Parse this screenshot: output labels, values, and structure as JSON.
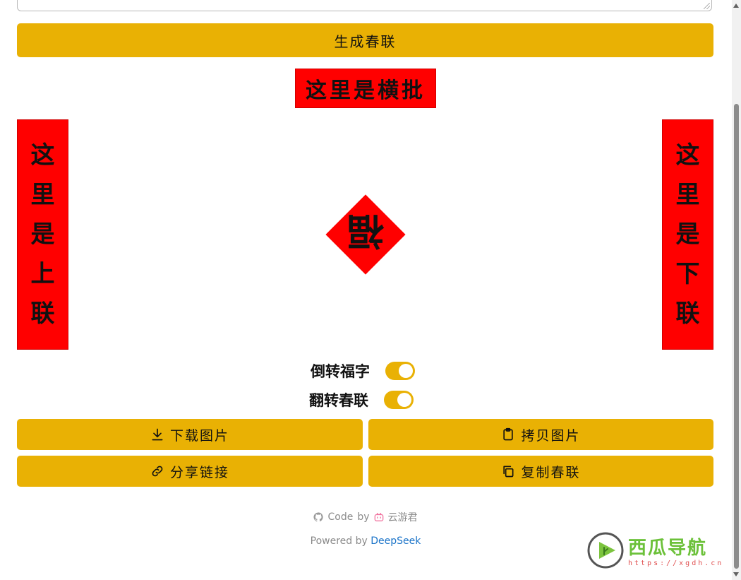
{
  "generate_button": "生成春联",
  "couplet": {
    "hengpi": "这里是横批",
    "upper": [
      "这",
      "里",
      "是",
      "上",
      "联"
    ],
    "lower": [
      "这",
      "里",
      "是",
      "下",
      "联"
    ],
    "fu": "福"
  },
  "toggles": {
    "invert_fu": {
      "label": "倒转福字",
      "on": true
    },
    "flip_couplet": {
      "label": "翻转春联",
      "on": true
    }
  },
  "actions": {
    "download": "下载图片",
    "copy_image": "拷贝图片",
    "share": "分享链接",
    "copy_text": "复制春联"
  },
  "footer": {
    "code": "Code",
    "by": "by",
    "author": "云游君",
    "powered": "Powered by",
    "engine": "DeepSeek"
  },
  "watermark": {
    "name": "西瓜导航",
    "url": "https://xgdh.cn"
  },
  "colors": {
    "accent": "#e9b104",
    "couplet_red": "#ff0000",
    "link": "#1a73c8"
  }
}
